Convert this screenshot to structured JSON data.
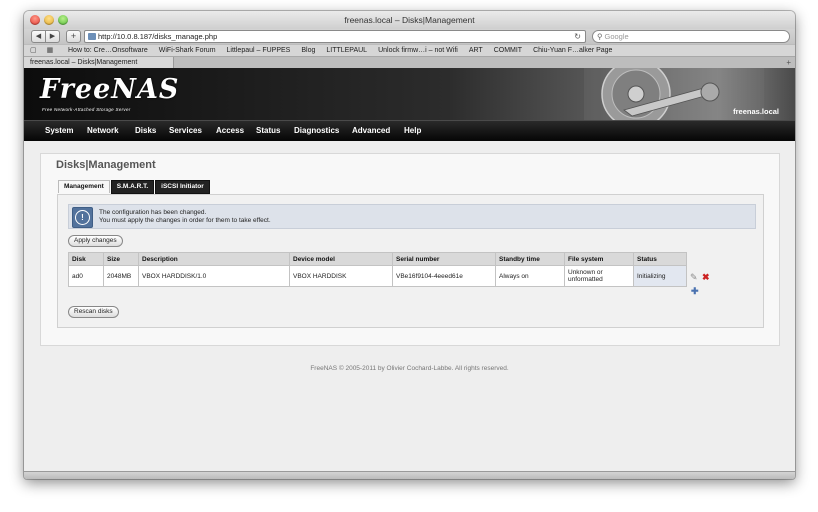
{
  "window": {
    "title": "freenas.local – Disks|Management"
  },
  "toolbar": {
    "back": "◀",
    "forward": "▶",
    "new_tab": "+",
    "url": "http://10.0.8.187/disks_manage.php",
    "search_placeholder": "Google"
  },
  "bookmarks": {
    "items": [
      "How to: Cre…Onsoftware",
      "WiFi-Shark Forum",
      "Littlepaul – FUPPES",
      "Blog",
      "LITTLEPAUL",
      "Unlock firmw…i – not Wifi",
      "ART",
      "COMMIT",
      "Chiu-Yuan F…alker Page"
    ]
  },
  "tab": {
    "label": "freenas.local – Disks|Management"
  },
  "banner": {
    "logo": "FreeNAS",
    "tagline": "Free Network-Attached Storage Server",
    "hostname": "freenas.local"
  },
  "menu": {
    "items": [
      "System",
      "Network",
      "Disks",
      "Services",
      "Access",
      "Status",
      "Diagnostics",
      "Advanced",
      "Help"
    ]
  },
  "page": {
    "title": "Disks|Management",
    "tabs": [
      "Management",
      "S.M.A.R.T.",
      "iSCSI Initiator"
    ]
  },
  "notice": {
    "line1": "The configuration has been changed.",
    "line2": "You must apply the changes in order for them to take effect."
  },
  "buttons": {
    "apply": "Apply changes",
    "rescan": "Rescan disks"
  },
  "table": {
    "headers": [
      "Disk",
      "Size",
      "Description",
      "Device model",
      "Serial number",
      "Standby time",
      "File system",
      "Status"
    ],
    "rows": [
      {
        "disk": "ad0",
        "size": "2048MB",
        "description": "VBOX HARDDISK/1.0",
        "device_model": "VBOX HARDDISK",
        "serial": "VBe16f9104-4eeed61e",
        "standby": "Always on",
        "filesystem_line1": "Unknown or",
        "filesystem_line2": "unformatted",
        "status": "Initializing"
      }
    ]
  },
  "footer": {
    "text": "FreeNAS © 2005-2011 by Olivier Cochard-Labbe. All rights reserved."
  },
  "colors": {
    "menu_bg": "#111111",
    "notice_bg": "#dde2ea",
    "status_cell": "#e2e7f0",
    "delete": "#cc2222",
    "add": "#4a72b0"
  }
}
